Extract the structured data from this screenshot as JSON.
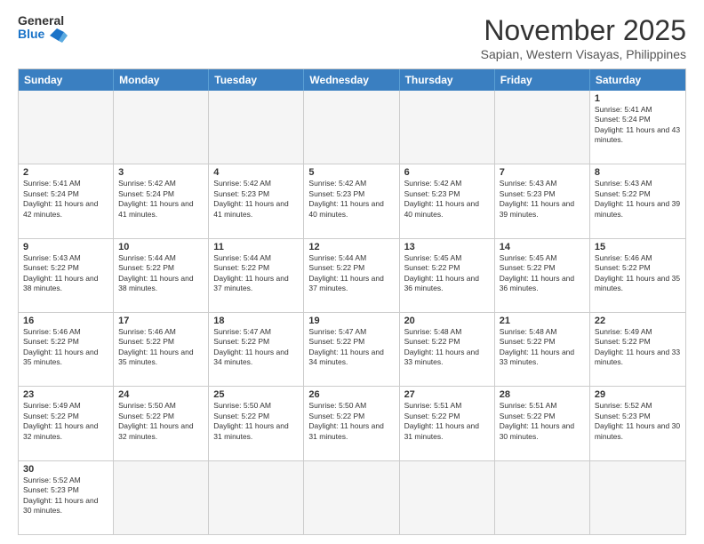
{
  "logo": {
    "text_general": "General",
    "text_blue": "Blue"
  },
  "header": {
    "month_title": "November 2025",
    "location": "Sapian, Western Visayas, Philippines"
  },
  "weekdays": [
    "Sunday",
    "Monday",
    "Tuesday",
    "Wednesday",
    "Thursday",
    "Friday",
    "Saturday"
  ],
  "weeks": [
    {
      "cells": [
        {
          "day": "",
          "empty": true
        },
        {
          "day": "",
          "empty": true
        },
        {
          "day": "",
          "empty": true
        },
        {
          "day": "",
          "empty": true
        },
        {
          "day": "",
          "empty": true
        },
        {
          "day": "",
          "empty": true
        },
        {
          "day": "1",
          "sunrise": "5:41 AM",
          "sunset": "5:24 PM",
          "daylight": "11 hours and 43 minutes."
        }
      ]
    },
    {
      "cells": [
        {
          "day": "2",
          "sunrise": "5:41 AM",
          "sunset": "5:24 PM",
          "daylight": "11 hours and 42 minutes."
        },
        {
          "day": "3",
          "sunrise": "5:42 AM",
          "sunset": "5:24 PM",
          "daylight": "11 hours and 41 minutes."
        },
        {
          "day": "4",
          "sunrise": "5:42 AM",
          "sunset": "5:23 PM",
          "daylight": "11 hours and 41 minutes."
        },
        {
          "day": "5",
          "sunrise": "5:42 AM",
          "sunset": "5:23 PM",
          "daylight": "11 hours and 40 minutes."
        },
        {
          "day": "6",
          "sunrise": "5:42 AM",
          "sunset": "5:23 PM",
          "daylight": "11 hours and 40 minutes."
        },
        {
          "day": "7",
          "sunrise": "5:43 AM",
          "sunset": "5:23 PM",
          "daylight": "11 hours and 39 minutes."
        },
        {
          "day": "8",
          "sunrise": "5:43 AM",
          "sunset": "5:22 PM",
          "daylight": "11 hours and 39 minutes."
        }
      ]
    },
    {
      "cells": [
        {
          "day": "9",
          "sunrise": "5:43 AM",
          "sunset": "5:22 PM",
          "daylight": "11 hours and 38 minutes."
        },
        {
          "day": "10",
          "sunrise": "5:44 AM",
          "sunset": "5:22 PM",
          "daylight": "11 hours and 38 minutes."
        },
        {
          "day": "11",
          "sunrise": "5:44 AM",
          "sunset": "5:22 PM",
          "daylight": "11 hours and 37 minutes."
        },
        {
          "day": "12",
          "sunrise": "5:44 AM",
          "sunset": "5:22 PM",
          "daylight": "11 hours and 37 minutes."
        },
        {
          "day": "13",
          "sunrise": "5:45 AM",
          "sunset": "5:22 PM",
          "daylight": "11 hours and 36 minutes."
        },
        {
          "day": "14",
          "sunrise": "5:45 AM",
          "sunset": "5:22 PM",
          "daylight": "11 hours and 36 minutes."
        },
        {
          "day": "15",
          "sunrise": "5:46 AM",
          "sunset": "5:22 PM",
          "daylight": "11 hours and 35 minutes."
        }
      ]
    },
    {
      "cells": [
        {
          "day": "16",
          "sunrise": "5:46 AM",
          "sunset": "5:22 PM",
          "daylight": "11 hours and 35 minutes."
        },
        {
          "day": "17",
          "sunrise": "5:46 AM",
          "sunset": "5:22 PM",
          "daylight": "11 hours and 35 minutes."
        },
        {
          "day": "18",
          "sunrise": "5:47 AM",
          "sunset": "5:22 PM",
          "daylight": "11 hours and 34 minutes."
        },
        {
          "day": "19",
          "sunrise": "5:47 AM",
          "sunset": "5:22 PM",
          "daylight": "11 hours and 34 minutes."
        },
        {
          "day": "20",
          "sunrise": "5:48 AM",
          "sunset": "5:22 PM",
          "daylight": "11 hours and 33 minutes."
        },
        {
          "day": "21",
          "sunrise": "5:48 AM",
          "sunset": "5:22 PM",
          "daylight": "11 hours and 33 minutes."
        },
        {
          "day": "22",
          "sunrise": "5:49 AM",
          "sunset": "5:22 PM",
          "daylight": "11 hours and 33 minutes."
        }
      ]
    },
    {
      "cells": [
        {
          "day": "23",
          "sunrise": "5:49 AM",
          "sunset": "5:22 PM",
          "daylight": "11 hours and 32 minutes."
        },
        {
          "day": "24",
          "sunrise": "5:50 AM",
          "sunset": "5:22 PM",
          "daylight": "11 hours and 32 minutes."
        },
        {
          "day": "25",
          "sunrise": "5:50 AM",
          "sunset": "5:22 PM",
          "daylight": "11 hours and 31 minutes."
        },
        {
          "day": "26",
          "sunrise": "5:50 AM",
          "sunset": "5:22 PM",
          "daylight": "11 hours and 31 minutes."
        },
        {
          "day": "27",
          "sunrise": "5:51 AM",
          "sunset": "5:22 PM",
          "daylight": "11 hours and 31 minutes."
        },
        {
          "day": "28",
          "sunrise": "5:51 AM",
          "sunset": "5:22 PM",
          "daylight": "11 hours and 30 minutes."
        },
        {
          "day": "29",
          "sunrise": "5:52 AM",
          "sunset": "5:23 PM",
          "daylight": "11 hours and 30 minutes."
        }
      ]
    },
    {
      "cells": [
        {
          "day": "30",
          "sunrise": "5:52 AM",
          "sunset": "5:23 PM",
          "daylight": "11 hours and 30 minutes."
        },
        {
          "day": "",
          "empty": true
        },
        {
          "day": "",
          "empty": true
        },
        {
          "day": "",
          "empty": true
        },
        {
          "day": "",
          "empty": true
        },
        {
          "day": "",
          "empty": true
        },
        {
          "day": "",
          "empty": true
        }
      ]
    }
  ]
}
